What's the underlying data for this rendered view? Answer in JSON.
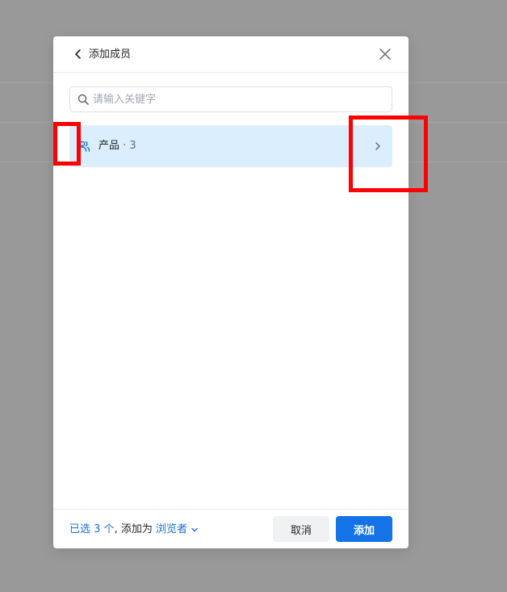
{
  "dialog": {
    "title": "添加成员"
  },
  "search": {
    "placeholder": "请输入关键字",
    "value": ""
  },
  "groups": [
    {
      "name": "产品",
      "separator": " · ",
      "count": "3"
    }
  ],
  "footer": {
    "selected_prefix": "已选 ",
    "selected_count": "3",
    "selected_suffix": " 个",
    "add_as_text": ", 添加为 ",
    "role": "浏览者",
    "cancel_label": "取消",
    "add_label": "添加"
  },
  "colors": {
    "overlay": "#999999",
    "accent": "#1473e6",
    "selected_row": "#dbeefd",
    "annotation": "#ff0000"
  },
  "icons": [
    "chevron-left-icon",
    "close-icon",
    "search-icon",
    "group-users-icon",
    "chevron-right-icon",
    "chevron-down-icon"
  ]
}
